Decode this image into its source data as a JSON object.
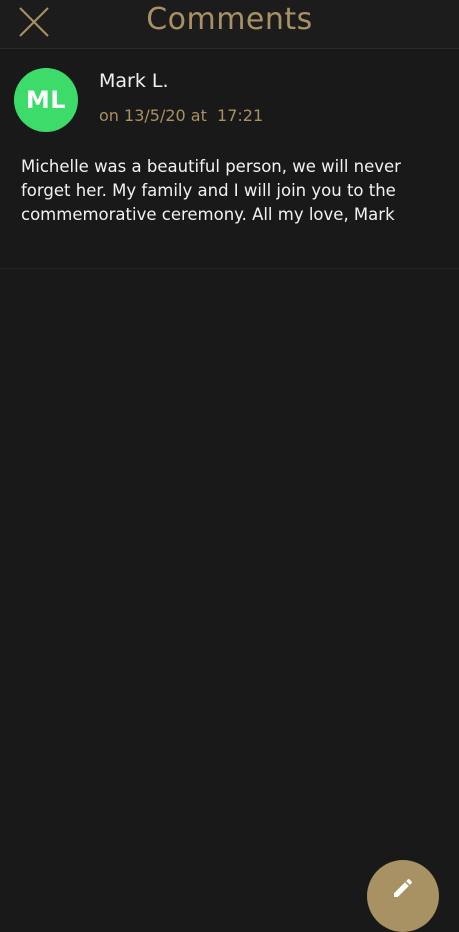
{
  "header": {
    "title": "Comments",
    "close_icon": "close-icon"
  },
  "comments": [
    {
      "avatar_initials": "ML",
      "avatar_color": "#3ddc6a",
      "author": "Mark L.",
      "meta": "on 13/5/20 at  17:21",
      "text": "Michelle was a beautiful person, we will never forget her. My family and I will join you to the commemorative ceremony. All my love, Mark"
    }
  ],
  "fab": {
    "icon": "pencil-icon"
  },
  "colors": {
    "background": "#191919",
    "accent": "#a89163",
    "text": "#f2f2f2"
  }
}
